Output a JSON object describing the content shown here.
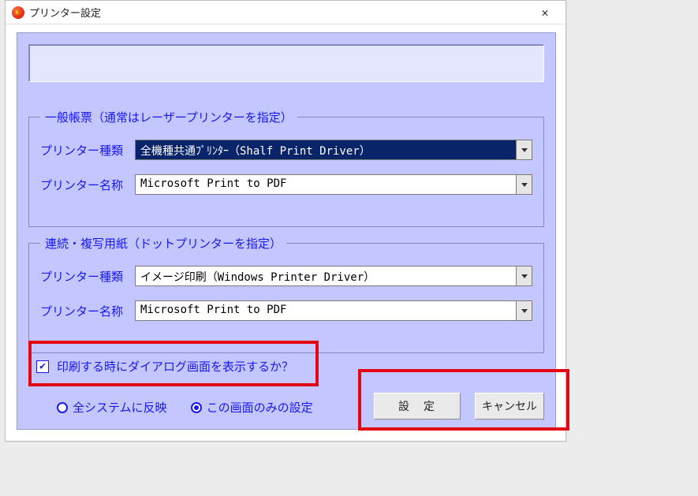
{
  "window": {
    "title": "プリンター設定"
  },
  "group1": {
    "legend": "一般帳票（通常はレーザープリンターを指定）",
    "row_type_label": "プリンター種類",
    "row_type_value": "全機種共通ﾌﾟﾘﾝﾀｰ（Shalf Print Driver）",
    "row_name_label": "プリンター名称",
    "row_name_value": "Microsoft Print to PDF"
  },
  "group2": {
    "legend": "連続・複写用紙（ドットプリンターを指定）",
    "row_type_label": "プリンター種類",
    "row_type_value": "イメージ印刷（Windows Printer Driver）",
    "row_name_label": "プリンター名称",
    "row_name_value": "Microsoft Print to PDF"
  },
  "checkbox_label": "印刷する時にダイアログ画面を表示するか？",
  "radios": {
    "all": "全システムに反映",
    "this": "この画面のみの設定"
  },
  "buttons": {
    "set": "設　定",
    "cancel": "キャンセル"
  }
}
